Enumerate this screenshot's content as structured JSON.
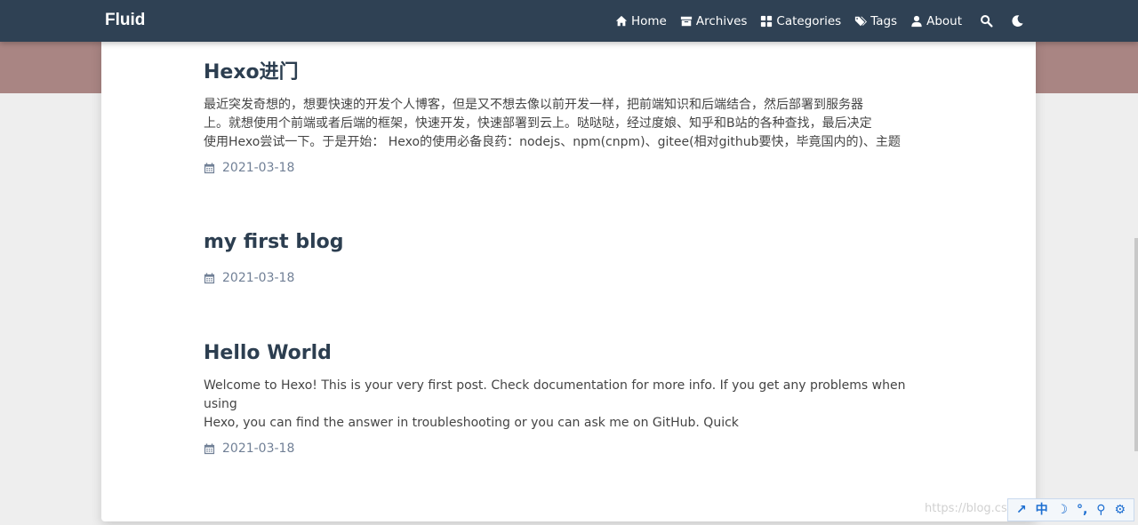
{
  "navbar": {
    "brand": "Fluid",
    "items": [
      {
        "label": "Home",
        "icon": "home-icon"
      },
      {
        "label": "Archives",
        "icon": "archive-icon"
      },
      {
        "label": "Categories",
        "icon": "categories-icon"
      },
      {
        "label": "Tags",
        "icon": "tags-icon"
      },
      {
        "label": "About",
        "icon": "user-icon"
      }
    ],
    "search_icon": "search-icon",
    "theme_icon": "moon-icon"
  },
  "posts": [
    {
      "title": "Hexo进门",
      "excerpt_lines": [
        "最近突发奇想的，想要快速的开发个人博客，但是又不想去像以前开发一样，把前端知识和后端结合，然后部署到服务器",
        "上。就想使用个前端或者后端的框架，快速开发，快速部署到云上。哒哒哒，经过度娘、知乎和B站的各种查找，最后决定",
        "使用Hexo尝试一下。于是开始： Hexo的使用必备良药：nodejs、npm(cnpm)、gitee(相对github要快，毕竟国内的)、主题"
      ],
      "date": "2021-03-18"
    },
    {
      "title": "my first blog",
      "excerpt_lines": [],
      "date": "2021-03-18"
    },
    {
      "title": "Hello World",
      "excerpt_lines": [
        "Welcome to Hexo! This is your very first post. Check documentation for more info. If you get any problems when using",
        "Hexo, you can find the answer in troubleshooting or you can ask me on GitHub. Quick"
      ],
      "date": "2021-03-18"
    }
  ],
  "watermark": "https://blog.cs",
  "toolbar": {
    "items": [
      "↗",
      "中",
      "☽",
      "°,",
      "⚲",
      "⚙"
    ]
  },
  "colors": {
    "navbar_bg": "#2f4154",
    "banner_bg": "#a98583",
    "title_color": "#2c3e50",
    "meta_color": "#718096"
  }
}
